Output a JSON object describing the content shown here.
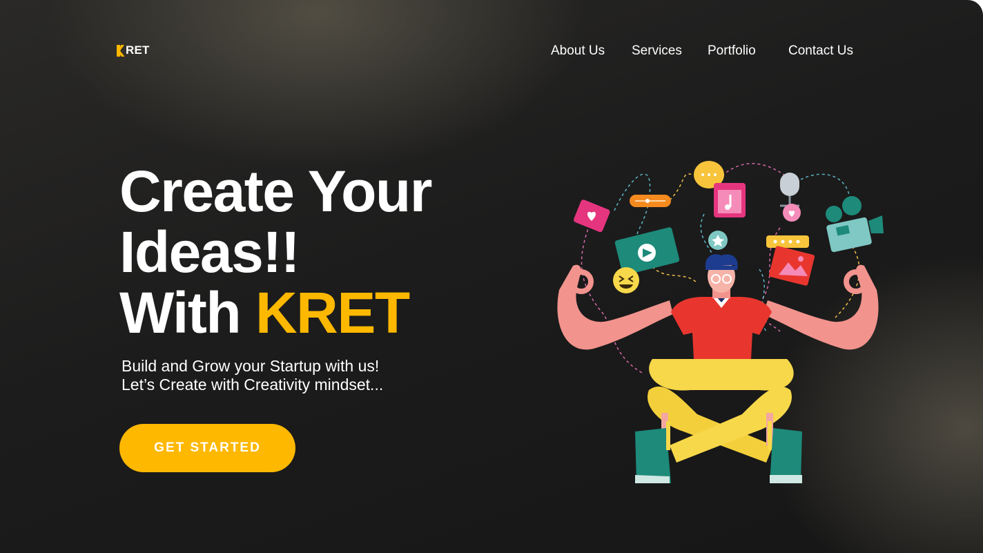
{
  "brand": {
    "logo_text": "RET",
    "accent_color": "#ffb800"
  },
  "nav": {
    "items": [
      {
        "label": "About Us"
      },
      {
        "label": "Services"
      },
      {
        "label": "Portfolio"
      },
      {
        "label": "Contact Us"
      }
    ]
  },
  "hero": {
    "headline_line1": "Create Your",
    "headline_line2": "Ideas!!",
    "headline_line3_prefix": "With ",
    "headline_line3_brand": "KRET",
    "subtitle_line1": "Build and Grow your Startup with us!",
    "subtitle_line2": "Let’s Create with Creativity mindset...",
    "cta_label": "GET STARTED"
  },
  "illustration": {
    "icons": [
      "heart-message-icon",
      "slider-icon",
      "speech-bubble-icon",
      "music-note-icon",
      "microphone-icon",
      "film-camera-icon",
      "video-player-icon",
      "star-badge-icon",
      "rating-stars-icon",
      "laughing-emoji-icon",
      "image-icon",
      "heart-badge-icon"
    ]
  }
}
